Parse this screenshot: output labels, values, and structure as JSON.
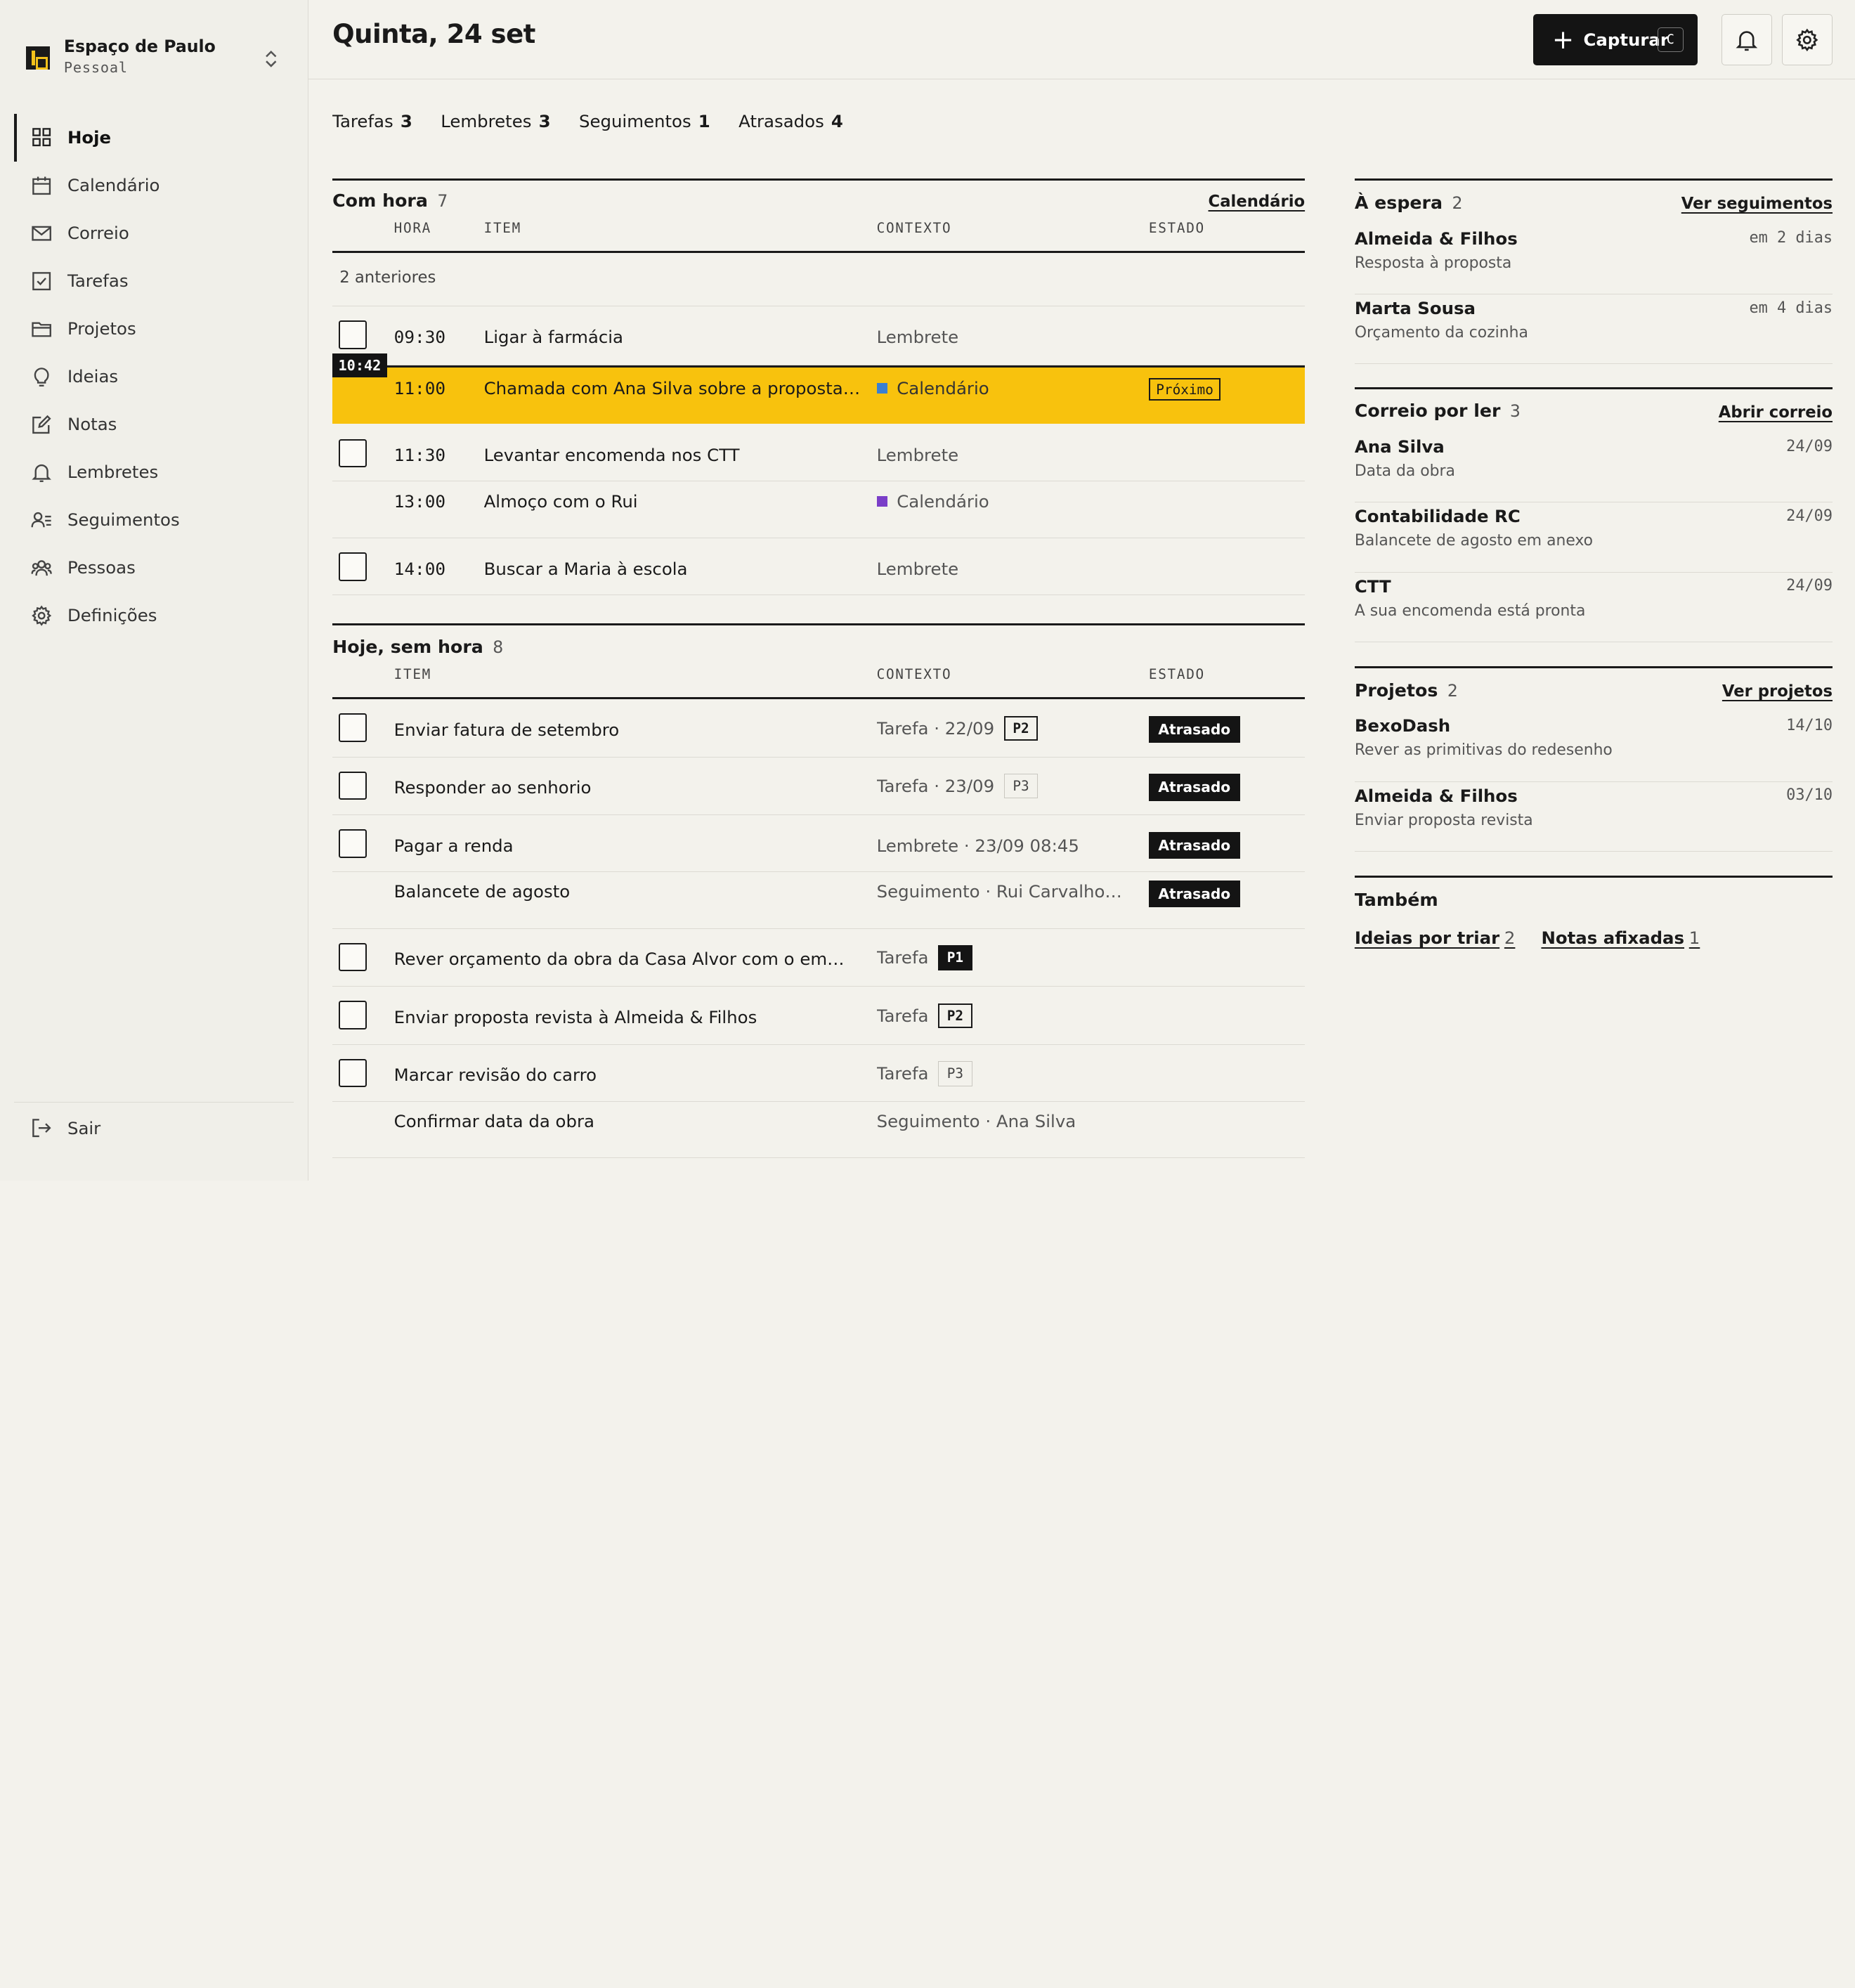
{
  "workspace": {
    "name": "Espaço de Paulo",
    "type": "Pessoal"
  },
  "nav": [
    {
      "label": "Hoje",
      "icon": "grid-icon",
      "active": true
    },
    {
      "label": "Calendário",
      "icon": "calendar-icon"
    },
    {
      "label": "Correio",
      "icon": "mail-icon"
    },
    {
      "label": "Tarefas",
      "icon": "checkbox-icon"
    },
    {
      "label": "Projetos",
      "icon": "folder-icon"
    },
    {
      "label": "Ideias",
      "icon": "lightbulb-icon"
    },
    {
      "label": "Notas",
      "icon": "note-icon"
    },
    {
      "label": "Lembretes",
      "icon": "bell-icon"
    },
    {
      "label": "Seguimentos",
      "icon": "followup-icon"
    },
    {
      "label": "Pessoas",
      "icon": "people-icon"
    },
    {
      "label": "Definições",
      "icon": "gear-icon"
    }
  ],
  "logout": "Sair",
  "header": {
    "title": "Quinta, 24 set",
    "capture_label": "Capturar",
    "capture_shortcut": "C"
  },
  "counts": [
    {
      "label": "Tarefas",
      "n": "3"
    },
    {
      "label": "Lembretes",
      "n": "3"
    },
    {
      "label": "Seguimentos",
      "n": "1"
    },
    {
      "label": "Atrasados",
      "n": "4"
    }
  ],
  "timed": {
    "title": "Com hora",
    "count": "7",
    "link": "Calendário",
    "cols": {
      "time": "HORA",
      "item": "ITEM",
      "context": "CONTEXTO",
      "status": "ESTADO"
    },
    "earlier": "2 anteriores",
    "now": "10:42",
    "rows": [
      {
        "time": "09:30",
        "item": "Ligar à farmácia",
        "context": "Lembrete",
        "checkbox": true
      },
      {
        "time": "11:00",
        "item": "Chamada com Ana Silva sobre a proposta ...",
        "context": "Calendário",
        "status": "Próximo",
        "highlight": true,
        "color": "#3b7fd1"
      },
      {
        "time": "11:30",
        "item": "Levantar encomenda nos CTT",
        "context": "Lembrete",
        "checkbox": true
      },
      {
        "time": "13:00",
        "item": "Almoço com o Rui",
        "context": "Calendário",
        "color": "#7a3ec8"
      },
      {
        "time": "14:00",
        "item": "Buscar a Maria à escola",
        "context": "Lembrete",
        "checkbox": true
      }
    ]
  },
  "untimed": {
    "title": "Hoje, sem hora",
    "count": "8",
    "cols": {
      "item": "ITEM",
      "context": "CONTEXTO",
      "status": "ESTADO"
    },
    "rows": [
      {
        "item": "Enviar fatura de setembro",
        "context": "Tarefa · 22/09",
        "prio": "P2",
        "status": "Atrasado",
        "checkbox": true
      },
      {
        "item": "Responder ao senhorio",
        "context": "Tarefa · 23/09",
        "prio": "P3",
        "status": "Atrasado",
        "checkbox": true
      },
      {
        "item": "Pagar a renda",
        "context": "Lembrete · 23/09 08:45",
        "status": "Atrasado",
        "checkbox": true
      },
      {
        "item": "Balancete de agosto",
        "context": "Seguimento · Rui Carvalho · ...",
        "status": "Atrasado"
      },
      {
        "item": "Rever orçamento da obra da Casa Alvor com o empr...",
        "context": "Tarefa",
        "prio": "P1",
        "checkbox": true
      },
      {
        "item": "Enviar proposta revista à Almeida & Filhos",
        "context": "Tarefa",
        "prio": "P2",
        "checkbox": true
      },
      {
        "item": "Marcar revisão do carro",
        "context": "Tarefa",
        "prio": "P3",
        "checkbox": true
      },
      {
        "item": "Confirmar data da obra",
        "context": "Seguimento · Ana Silva"
      }
    ]
  },
  "waiting": {
    "title": "À espera",
    "count": "2",
    "link": "Ver seguimentos",
    "items": [
      {
        "name": "Almeida & Filhos",
        "sub": "Resposta à proposta",
        "meta": "em 2 dias"
      },
      {
        "name": "Marta Sousa",
        "sub": "Orçamento da cozinha",
        "meta": "em 4 dias"
      }
    ]
  },
  "mail": {
    "title": "Correio por ler",
    "count": "3",
    "link": "Abrir correio",
    "items": [
      {
        "name": "Ana Silva",
        "sub": "Data da obra",
        "meta": "24/09"
      },
      {
        "name": "Contabilidade RC",
        "sub": "Balancete de agosto em anexo",
        "meta": "24/09"
      },
      {
        "name": "CTT",
        "sub": "A sua encomenda está pronta",
        "meta": "24/09"
      }
    ]
  },
  "projects": {
    "title": "Projetos",
    "count": "2",
    "link": "Ver projetos",
    "items": [
      {
        "name": "BexoDash",
        "sub": "Rever as primitivas do redesenho",
        "meta": "14/10"
      },
      {
        "name": "Almeida & Filhos",
        "sub": "Enviar proposta revista",
        "meta": "03/10"
      }
    ]
  },
  "also": {
    "title": "Também",
    "links": [
      {
        "label": "Ideias por triar",
        "n": "2"
      },
      {
        "label": "Notas afixadas",
        "n": "1"
      }
    ]
  }
}
